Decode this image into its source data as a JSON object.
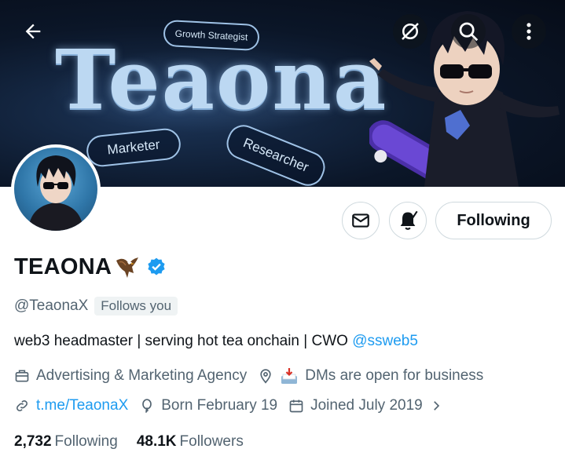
{
  "banner": {
    "title": "Teaona",
    "pills": {
      "growth": "Growth Strategist",
      "marketer": "Marketer",
      "researcher": "Researcher"
    }
  },
  "header": {
    "icons": [
      "back-arrow-icon",
      "offline-icon",
      "search-icon",
      "more-vertical-icon"
    ]
  },
  "actions": {
    "following_label": "Following"
  },
  "profile": {
    "display_name": "TEAONA",
    "handle": "@TeaonaX",
    "follows_you": "Follows you",
    "bio_text": "web3 headmaster | serving hot tea onchain | CWO ",
    "bio_mention": "@ssweb5",
    "category": "Advertising & Marketing Agency",
    "location": "DMs are open for business",
    "website": "t.me/TeaonaX",
    "birthday": "Born February 19",
    "joined": "Joined July 2019",
    "following_count": "2,732",
    "following_label": "Following",
    "followers_count": "48.1K",
    "followers_label": "Followers"
  },
  "colors": {
    "accent": "#1d9bf0",
    "muted": "#536471",
    "text": "#0f1419",
    "border": "#cfd9de"
  }
}
